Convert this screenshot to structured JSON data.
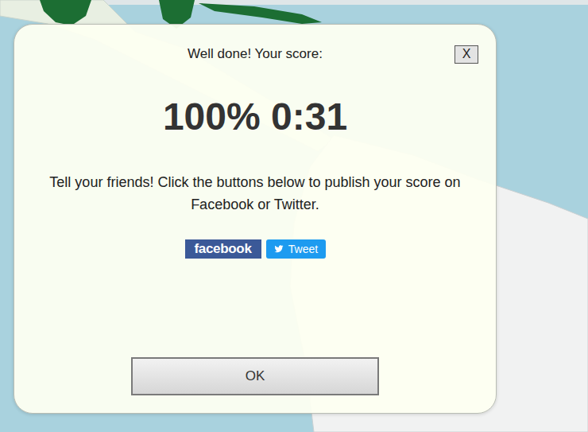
{
  "dialog": {
    "heading": "Well done! Your score:",
    "close": "X",
    "score": "100% 0:31",
    "message": "Tell your friends! Click the buttons below to publish your score on Facebook or Twitter.",
    "share_buttons": [
      {
        "label": "facebook",
        "color": "#3b5998",
        "kind": "facebook"
      },
      {
        "label": "Tweet",
        "color": "#1d9bf0",
        "kind": "twitter"
      }
    ],
    "buttons": [
      "OK"
    ]
  }
}
